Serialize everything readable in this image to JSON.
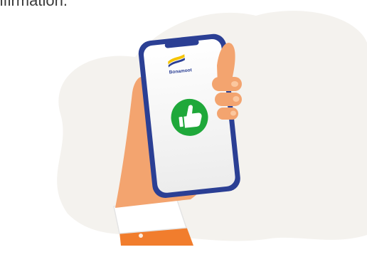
{
  "page": {
    "caption": "onfirmation."
  },
  "phone": {
    "brand_name": "Bonamoot",
    "status_icon": "thumbs-up-icon",
    "colors": {
      "frame": "#2b3f94",
      "screen_top": "#ffffff",
      "screen_bottom": "#ececec",
      "status_circle": "#1fa83a",
      "brand_yellow": "#f5c400",
      "brand_blue": "#2b3f94"
    }
  },
  "illustration": {
    "background_blob": "#f4f2ee",
    "skin": "#f3a46f",
    "skin_shadow": "#e98c55",
    "cuff": "#ffffff",
    "sleeve": "#f17d2d"
  }
}
